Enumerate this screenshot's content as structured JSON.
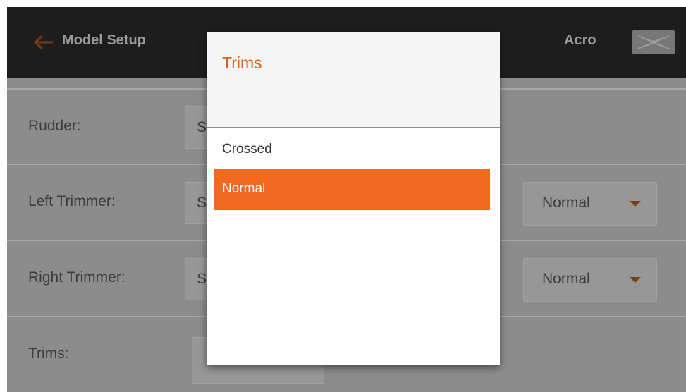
{
  "header": {
    "back_icon": "arrow-left-icon",
    "title": "Model Setup",
    "mode": "Acro",
    "model_icon": "airplane-icon"
  },
  "rows": [
    {
      "label": "Rudder:",
      "left_value": "S"
    },
    {
      "label": "Left Trimmer:",
      "left_value": "S",
      "right_value": "Normal"
    },
    {
      "label": "Right Trimmer:",
      "left_value": "S",
      "right_value": "Normal"
    },
    {
      "label": "Trims:"
    }
  ],
  "dialog": {
    "title": "Trims",
    "options": [
      "Crossed",
      "Normal"
    ],
    "selected": "Normal"
  },
  "colors": {
    "accent": "#f26a1f",
    "header_bg": "#1d1d1d"
  }
}
